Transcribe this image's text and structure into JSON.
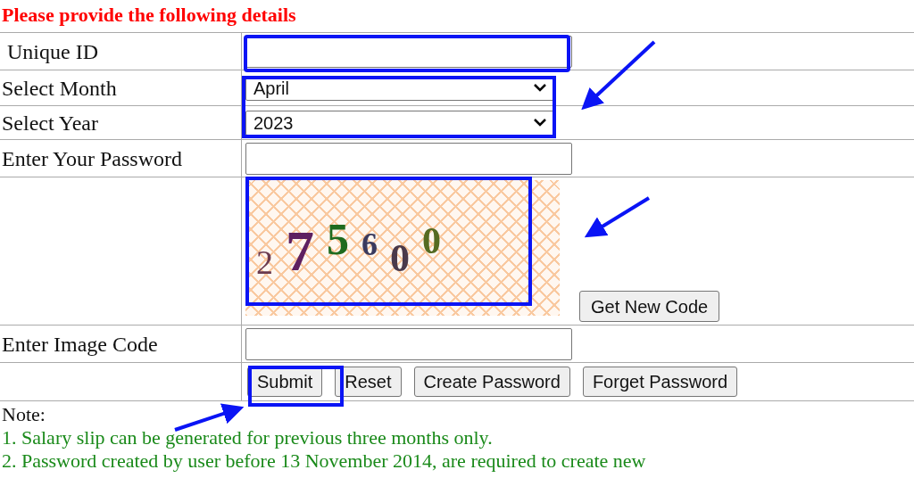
{
  "heading": "Please provide the following details",
  "rows": [
    {
      "kind": "text",
      "label": "Unique ID",
      "value": ""
    },
    {
      "kind": "select",
      "label": "Select Month",
      "value": "April"
    },
    {
      "kind": "select",
      "label": "Select Year",
      "value": "2023"
    },
    {
      "kind": "password",
      "label": "Enter Your Password",
      "value": ""
    },
    {
      "kind": "captcha",
      "characters": [
        {
          "text": "2",
          "color": "#6b3a4e"
        },
        {
          "text": "7",
          "color": "#5e2060"
        },
        {
          "text": "5",
          "color": "#1f6b1f"
        },
        {
          "text": "6",
          "color": "#3a3a5e"
        },
        {
          "text": "0",
          "color": "#4a3a4a"
        },
        {
          "text": "0",
          "color": "#556b22"
        }
      ],
      "button": "Get New Code"
    },
    {
      "kind": "text",
      "label": "Enter Image Code",
      "value": ""
    },
    {
      "kind": "buttons",
      "buttons": [
        "Submit",
        "Reset",
        "Create Password",
        "Forget Password"
      ]
    }
  ],
  "note": {
    "title": "Note:",
    "items": [
      "1. Salary slip can be generated for previous three months only.",
      "2. Password created by user before 13 November 2014, are required to create new"
    ]
  }
}
